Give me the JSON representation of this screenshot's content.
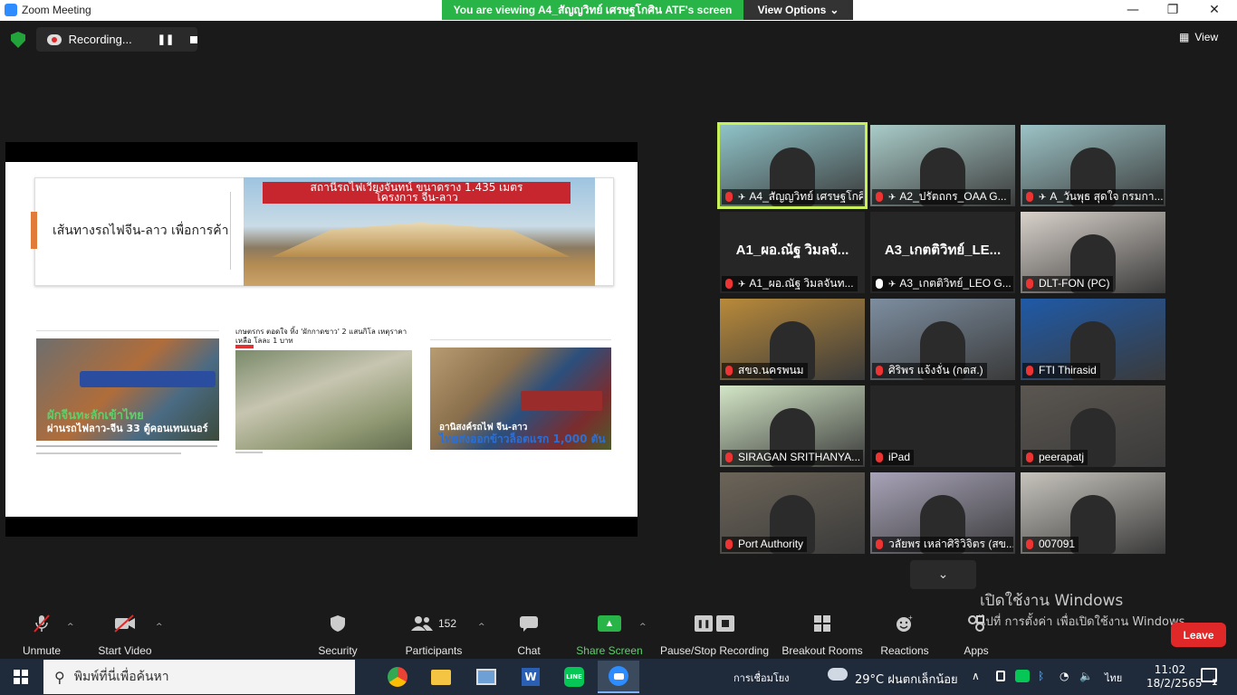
{
  "window": {
    "title": "Zoom Meeting",
    "viewing_banner": "You are viewing A4_สัญญวิทย์ เศรษฐโกศิน ATF's screen",
    "view_options": "View Options",
    "minimize": "—",
    "restore": "❐",
    "close": "✕"
  },
  "meeting": {
    "recording_label": "Recording...",
    "view_label": "View",
    "more_participants": "⌄"
  },
  "slide": {
    "title": "เส้นทางรถไฟจีน-ลาว เพื่อการค้า",
    "station_banner_line1": "สถานีรถไฟเวียงจันทน์ ขนาดราง 1.435 เมตร",
    "station_banner_line2": "โครงการ จีน-ลาว",
    "news1_overlay_big": "ผักจีนทะลักเข้าไทย",
    "news1_overlay_small": "ผ่านรถไฟลาว-จีน 33 ตู้คอนเทนเนอร์",
    "news2_title": "เกษตรกร ตอดใจ ทิ้ง 'ผักกาดขาว' 2 แสนกิโล เหตุราคาเหลือ โลละ 1 บาท",
    "news3_overlay_small": "อานิสงค์รถไฟ จีน-ลาว",
    "news3_overlay_big": "ไทยส่งออกข้าวล็อตแรก 1,000 ตัน"
  },
  "participants": [
    {
      "name": "A4_สัญญวิทย์ เศรษฐโกศิ...",
      "muted": true,
      "pinned": true,
      "display": "video",
      "color": "#8fc3c8"
    },
    {
      "name": "A2_ปรัตถกร_OAA G...",
      "muted": true,
      "pinned": true,
      "display": "video",
      "color": "#a9ccc9"
    },
    {
      "name": "A_วันพุธ สุดใจ กรมกา...",
      "muted": true,
      "pinned": true,
      "display": "video",
      "color": "#9cc3c6"
    },
    {
      "name": "A1_ผอ.ณัฐ วิมลจันท...",
      "muted": true,
      "pinned": true,
      "display": "name",
      "big_name": "A1_ผอ.ณัฐ วิมลจั...",
      "color": "#262626"
    },
    {
      "name": "A3_เกตติวิทย์_LEO G...",
      "muted": false,
      "pinned": true,
      "display": "name",
      "big_name": "A3_เกตติวิทย์_LE...",
      "color": "#262626"
    },
    {
      "name": "DLT-FON (PC)",
      "muted": true,
      "pinned": false,
      "display": "video",
      "color": "#d9d2cb"
    },
    {
      "name": "สขจ.นครพนม",
      "muted": true,
      "pinned": false,
      "display": "video",
      "color": "#b98a3a"
    },
    {
      "name": "ศิริพร แจ้งจั่น (กตส.)",
      "muted": true,
      "pinned": false,
      "display": "video",
      "color": "#7d8ea0"
    },
    {
      "name": "FTI Thirasid",
      "muted": true,
      "pinned": false,
      "display": "video",
      "color": "#1f5aa8"
    },
    {
      "name": "SIRAGAN SRITHANYA...",
      "muted": true,
      "pinned": false,
      "display": "video",
      "color": "#d3e6c6"
    },
    {
      "name": "iPad",
      "muted": true,
      "pinned": false,
      "display": "blank",
      "color": "#262626"
    },
    {
      "name": "peerapatj",
      "muted": true,
      "pinned": false,
      "display": "video",
      "color": "#5b5650"
    },
    {
      "name": "Port Authority",
      "muted": true,
      "pinned": false,
      "display": "video",
      "color": "#6c6458"
    },
    {
      "name": "วลัยพร เหล่าศิริวิจิตร (สข...",
      "muted": true,
      "pinned": false,
      "display": "video",
      "color": "#a8a3b8"
    },
    {
      "name": "007091",
      "muted": true,
      "pinned": false,
      "display": "video",
      "color": "#c7c4bd"
    }
  ],
  "toolbar": {
    "unmute": "Unmute",
    "start_video": "Start Video",
    "security": "Security",
    "participants": "Participants",
    "participants_count": "152",
    "chat": "Chat",
    "share_screen": "Share Screen",
    "pause_stop_recording": "Pause/Stop Recording",
    "breakout_rooms": "Breakout Rooms",
    "reactions": "Reactions",
    "apps": "Apps",
    "leave": "Leave"
  },
  "watermark": {
    "line1": "เปิดใช้งาน Windows",
    "line2": "ไปที่ การตั้งค่า เพื่อเปิดใช้งาน Windows"
  },
  "taskbar": {
    "search_placeholder": "พิมพ์ที่นี่เพื่อค้นหา",
    "network_label": "การเชื่อมโยง",
    "weather": "29°C ฝนตกเล็กน้อย",
    "language": "ไทย",
    "time": "11:02",
    "date": "18/2/2565",
    "notification_count": "1"
  },
  "colors": {
    "accent_green": "#28b446",
    "leave_red": "#e02828",
    "active_speaker": "#c7f05a"
  }
}
